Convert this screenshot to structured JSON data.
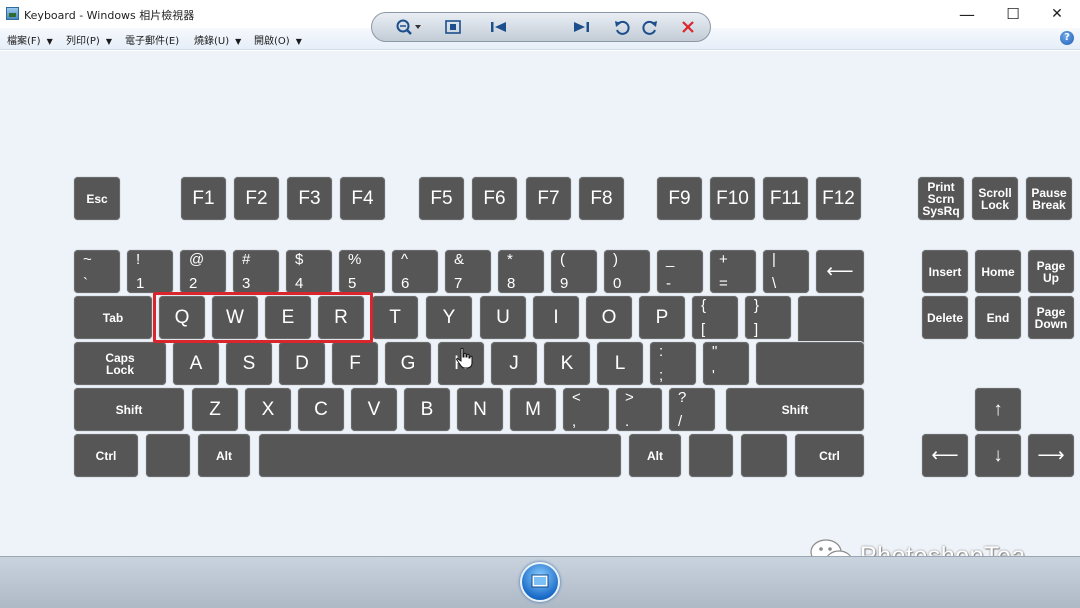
{
  "window": {
    "title": "Keyboard - Windows 相片檢視器",
    "controls": {
      "minimize": "—",
      "maximize": "☐",
      "close": "✕"
    }
  },
  "menu": [
    {
      "label": "檔案(F)"
    },
    {
      "label": "列印(P)"
    },
    {
      "label": "電子郵件(E)"
    },
    {
      "label": "燒錄(U)"
    },
    {
      "label": "開啟(O)"
    }
  ],
  "help": {
    "label": "?"
  },
  "keyboard": {
    "function_row": [
      "Esc",
      "F1",
      "F2",
      "F3",
      "F4",
      "F5",
      "F6",
      "F7",
      "F8",
      "F9",
      "F10",
      "F11",
      "F12"
    ],
    "system_keys": [
      "Print\nScrn\nSysRq",
      "Scroll\nLock",
      "Pause\nBreak"
    ],
    "number_row": [
      {
        "top": "~",
        "bot": "`"
      },
      {
        "top": "!",
        "bot": "1"
      },
      {
        "top": "@",
        "bot": "2"
      },
      {
        "top": "#",
        "bot": "3"
      },
      {
        "top": "$",
        "bot": "4"
      },
      {
        "top": "%",
        "bot": "5"
      },
      {
        "top": "^",
        "bot": "6"
      },
      {
        "top": "&",
        "bot": "7"
      },
      {
        "top": "*",
        "bot": "8"
      },
      {
        "top": "(",
        "bot": "9"
      },
      {
        "top": ")",
        "bot": "0"
      },
      {
        "top": "_",
        "bot": "-"
      },
      {
        "top": "+",
        "bot": "="
      },
      {
        "top": "|",
        "bot": "\\"
      }
    ],
    "backspace": "⟵",
    "tab": "Tab",
    "top_letters": [
      "Q",
      "W",
      "E",
      "R",
      "T",
      "Y",
      "U",
      "I",
      "O",
      "P"
    ],
    "brackets": [
      {
        "top": "{",
        "bot": "["
      },
      {
        "top": "}",
        "bot": "]"
      }
    ],
    "caps": "Caps\nLock",
    "home_letters": [
      "A",
      "S",
      "D",
      "F",
      "G",
      "H",
      "J",
      "K",
      "L"
    ],
    "home_punct": [
      {
        "top": ":",
        "bot": ";"
      },
      {
        "top": "\"",
        "bot": "'"
      }
    ],
    "shift": "Shift",
    "bottom_letters": [
      "Z",
      "X",
      "C",
      "V",
      "B",
      "N",
      "M"
    ],
    "bottom_punct": [
      {
        "top": "<",
        "bot": ","
      },
      {
        "top": ">",
        "bot": "."
      },
      {
        "top": "?",
        "bot": "/"
      }
    ],
    "ctrl": "Ctrl",
    "alt": "Alt",
    "nav_keys": [
      "Insert",
      "Home",
      "Page\nUp",
      "Delete",
      "End",
      "Page\nDown"
    ],
    "arrows": {
      "up": "↑",
      "left": "⟵",
      "down": "↓",
      "right": "⟶"
    }
  },
  "watermark": {
    "text": "PhotoshopTea"
  },
  "toolbar": {
    "buttons": [
      "zoom-icon",
      "fit-window-icon",
      "previous-icon",
      "slideshow-icon",
      "next-icon",
      "rotate-left-icon",
      "rotate-right-icon",
      "delete-icon"
    ],
    "accent": "#1b6cc9",
    "delete_color": "#d8262c"
  }
}
